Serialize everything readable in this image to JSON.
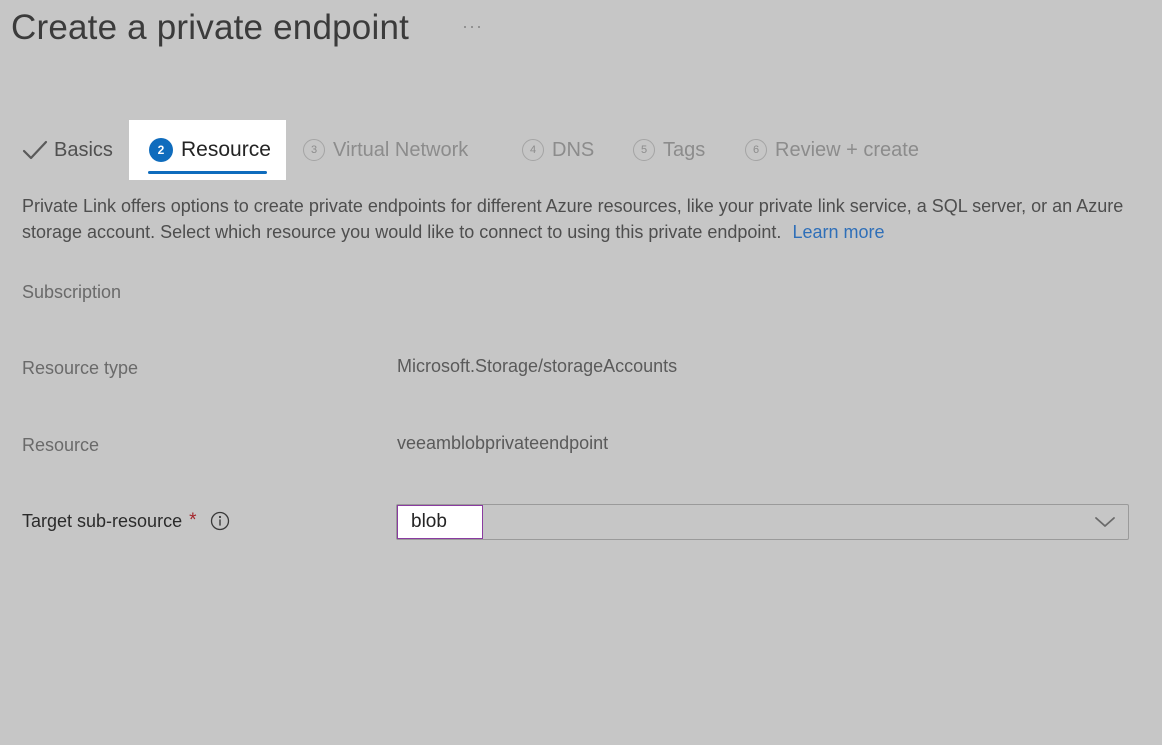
{
  "header": {
    "title": "Create a private endpoint",
    "more_label": "···"
  },
  "tabs": [
    {
      "label": "Basics",
      "step": "",
      "state": "completed"
    },
    {
      "label": "Resource",
      "step": "2",
      "state": "active"
    },
    {
      "label": "Virtual Network",
      "step": "3",
      "state": "inactive"
    },
    {
      "label": "DNS",
      "step": "4",
      "state": "inactive"
    },
    {
      "label": "Tags",
      "step": "5",
      "state": "inactive"
    },
    {
      "label": "Review + create",
      "step": "6",
      "state": "inactive"
    }
  ],
  "description": {
    "text": "Private Link offers options to create private endpoints for different Azure resources, like your private link service, a SQL server, or an Azure storage account. Select which resource you would like to connect to using this private endpoint.",
    "learn_more": "Learn more"
  },
  "form": {
    "subscription_label": "Subscription",
    "resource_type_label": "Resource type",
    "resource_type_value": "Microsoft.Storage/storageAccounts",
    "resource_label": "Resource",
    "resource_value": "veeamblobprivateendpoint",
    "target_label": "Target sub-resource",
    "required_mark": "*",
    "target_value": "blob"
  },
  "colors": {
    "accent": "#0f6cbd",
    "required": "#a4262c",
    "link": "#2f6fb8",
    "focus_border": "#8a3ba0"
  },
  "icons": {
    "check": "check-icon",
    "info": "info-icon",
    "chevron": "chevron-down-icon",
    "more": "more-icon"
  }
}
